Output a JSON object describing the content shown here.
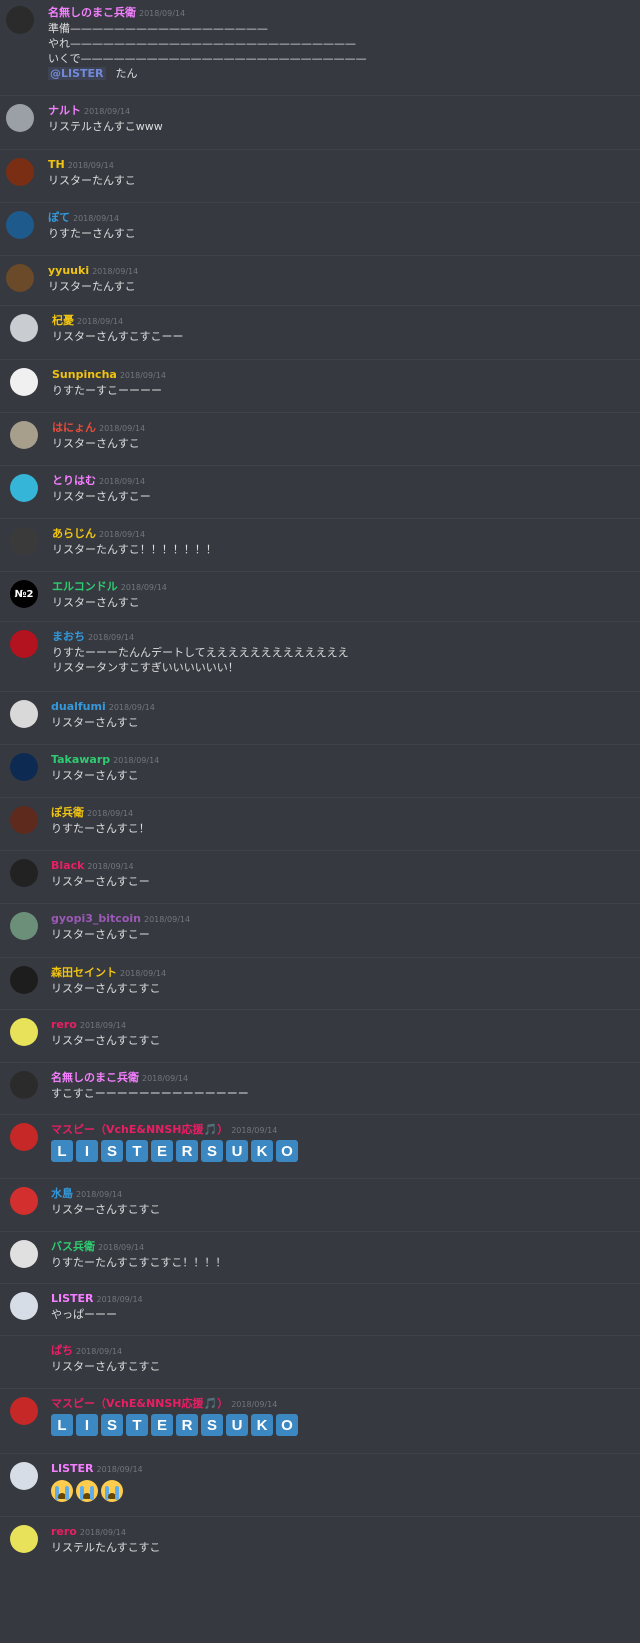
{
  "messages": [
    {
      "user": "名無しのまこ兵衛",
      "color": "#f47fff",
      "ts": "2018/09/14",
      "av": "#2b2b2b",
      "lines": [
        "準備——————————————————",
        "やれ——————————————————————————",
        "いくで——————————————————————————"
      ],
      "mention": "@LISTER",
      "mention_tail": "たん"
    },
    {
      "user": "ナルト",
      "color": "#f47fff",
      "ts": "2018/09/14",
      "av": "#9aa0a6",
      "lines": [
        "リステルさんすこwww"
      ]
    },
    {
      "user": "TH",
      "color": "#f1c40f",
      "ts": "2018/09/14",
      "av": "#7a2e13",
      "lines": [
        "リスターたんすこ"
      ]
    },
    {
      "user": "ぽて",
      "color": "#3498db",
      "ts": "2018/09/14",
      "av": "#1f5a8c",
      "lines": [
        "りすたーさんすこ"
      ]
    },
    {
      "user": "yyuuki",
      "color": "#f1c40f",
      "ts": "2018/09/14",
      "av": "#6b4a2a",
      "lines": [
        "リスターたんすこ"
      ]
    },
    {
      "user": "杞憂",
      "color": "#f1c40f",
      "ts": "2018/09/14",
      "av": "#c9ccd1",
      "lines": [
        "リスターさんすこすこーー"
      ]
    },
    {
      "user": "Sunpincha",
      "color": "#f1c40f",
      "ts": "2018/09/14",
      "av": "#f0f0f0",
      "lines": [
        "りすたーすこーーーー"
      ]
    },
    {
      "user": "はにょん",
      "color": "#e74c3c",
      "ts": "2018/09/14",
      "av": "#a79e8c",
      "lines": [
        "リスターさんすこ"
      ]
    },
    {
      "user": "とりはむ",
      "color": "#f47fff",
      "ts": "2018/09/14",
      "av": "#35b6d8",
      "lines": [
        "リスターさんすこー"
      ]
    },
    {
      "user": "あらじん",
      "color": "#f1c40f",
      "ts": "2018/09/14",
      "av": "#3a3a3a",
      "lines": [
        "リスターたんすこ！！！！！！！"
      ]
    },
    {
      "user": "エルコンドル",
      "color": "#2ecc71",
      "ts": "2018/09/14",
      "av": "#000000",
      "avtext": "№2",
      "lines": [
        "リスターさんすこ"
      ]
    },
    {
      "user": "まおち",
      "color": "#3498db",
      "ts": "2018/09/14",
      "av": "#b3131f",
      "lines": [
        "りすたーーーたんんデートしてえええええええええええええ",
        "リスタータンすこすぎいいいいいい！"
      ]
    },
    {
      "user": "dualfumi",
      "color": "#3498db",
      "ts": "2018/09/14",
      "av": "#d9d9d9",
      "lines": [
        "リスターさんすこ"
      ]
    },
    {
      "user": "Takawarp",
      "color": "#2ecc71",
      "ts": "2018/09/14",
      "av": "#0d2a52",
      "lines": [
        "リスターさんすこ"
      ]
    },
    {
      "user": "ぽ兵衛",
      "color": "#f1c40f",
      "ts": "2018/09/14",
      "av": "#5e2a1e",
      "lines": [
        "りすたーさんすこ！"
      ]
    },
    {
      "user": "Black",
      "color": "#e91e63",
      "ts": "2018/09/14",
      "av": "#222222",
      "lines": [
        "リスターさんすこー"
      ]
    },
    {
      "user": "gyopi3_bitcoin",
      "color": "#9b59b6",
      "ts": "2018/09/14",
      "av": "#6b8f79",
      "lines": [
        "リスターさんすこー"
      ]
    },
    {
      "user": "森田セイント",
      "color": "#f1c40f",
      "ts": "2018/09/14",
      "av": "#1d1d1d",
      "lines": [
        "リスターさんすこすこ"
      ]
    },
    {
      "user": "rero",
      "color": "#e91e63",
      "ts": "2018/09/14",
      "av": "#e8e25a",
      "lines": [
        "リスターさんすこすこ"
      ]
    },
    {
      "user": "名無しのまこ兵衛",
      "color": "#f47fff",
      "ts": "2018/09/14",
      "av": "#2b2b2b",
      "lines": [
        "すこすこーーーーーーーーーーーーーー"
      ]
    },
    {
      "user": "マスピー（VchE&NNSH応援🎵）",
      "color": "#e91e63",
      "ts": "2018/09/14",
      "av": "#c62828",
      "tiles": [
        "L",
        "I",
        "S",
        "T",
        "E",
        "R",
        "S",
        "U",
        "K",
        "O"
      ]
    },
    {
      "user": "水島",
      "color": "#3498db",
      "ts": "2018/09/14",
      "av": "#d32f2f",
      "lines": [
        "リスターさんすこすこ"
      ]
    },
    {
      "user": "バス兵衛",
      "color": "#2ecc71",
      "ts": "2018/09/14",
      "av": "#e0e0e0",
      "lines": [
        "りすたーたんすこすこすこ！！！！"
      ]
    },
    {
      "user": "LISTER",
      "color": "#f47fff",
      "ts": "2018/09/14",
      "av": "#d7dde6",
      "lines": [
        "やっぱーーー"
      ]
    },
    {
      "user": "ぱち",
      "color": "#e91e63",
      "ts": "2018/09/14",
      "av": "#36393f",
      "lines": [
        "リスターさんすこすこ"
      ]
    },
    {
      "user": "マスピー（VchE&NNSH応援🎵）",
      "color": "#e91e63",
      "ts": "2018/09/14",
      "av": "#c62828",
      "tiles": [
        "L",
        "I",
        "S",
        "T",
        "E",
        "R",
        "S",
        "U",
        "K",
        "O"
      ]
    },
    {
      "user": "LISTER",
      "color": "#f47fff",
      "ts": "2018/09/14",
      "av": "#d7dde6",
      "emoji_count": 3
    },
    {
      "user": "rero",
      "color": "#e91e63",
      "ts": "2018/09/14",
      "av": "#e8e25a",
      "lines": [
        "リステルたんすこすこ"
      ]
    }
  ]
}
